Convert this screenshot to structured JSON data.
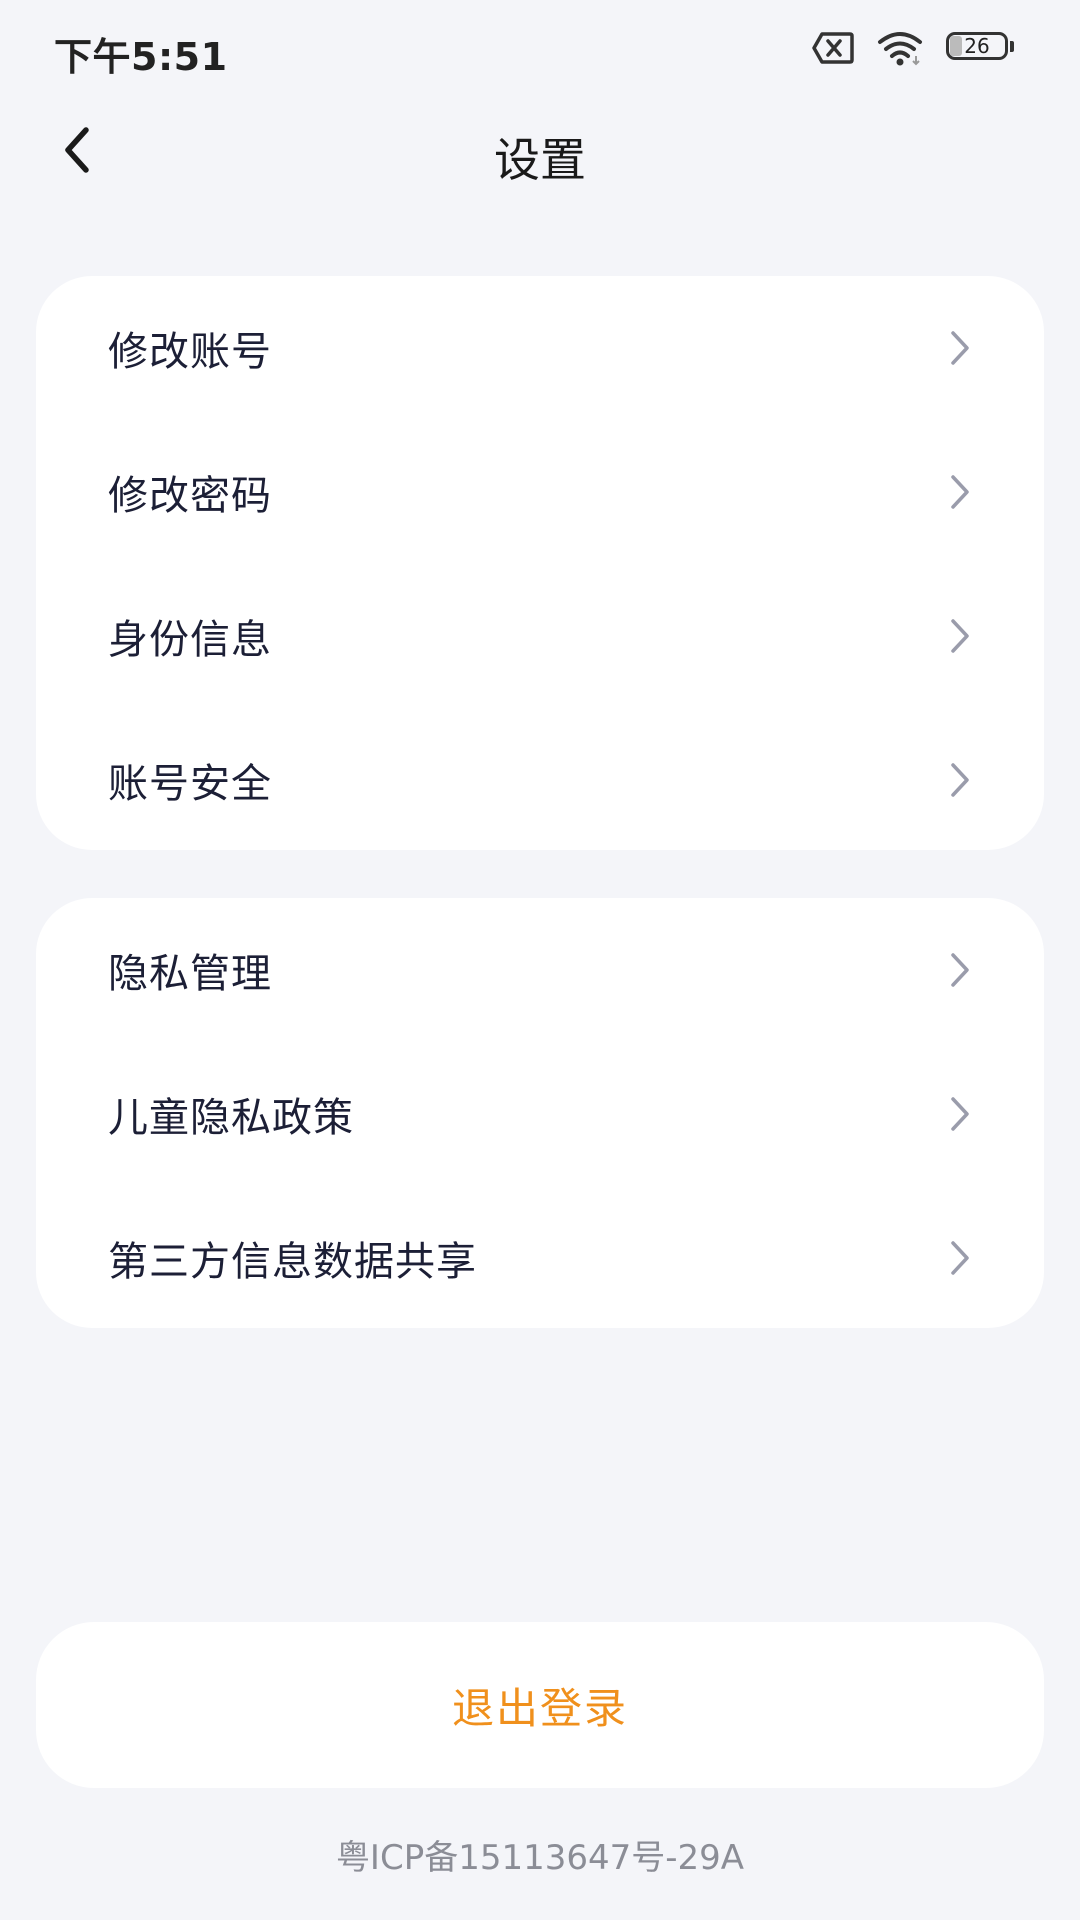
{
  "status_bar": {
    "time": "下午5:51",
    "battery_level": "26",
    "icons": [
      "sim-error-icon",
      "wifi-icon",
      "battery-icon"
    ]
  },
  "header": {
    "title": "设置",
    "back_icon": "chevron-left-icon"
  },
  "group_1": {
    "items": [
      {
        "label": "修改账号"
      },
      {
        "label": "修改密码"
      },
      {
        "label": "身份信息"
      },
      {
        "label": "账号安全"
      }
    ]
  },
  "group_2": {
    "items": [
      {
        "label": "隐私管理"
      },
      {
        "label": "儿童隐私政策"
      },
      {
        "label": "第三方信息数据共享"
      }
    ]
  },
  "logout": {
    "label": "退出登录",
    "color": "#f0901c"
  },
  "footer": {
    "icp": "粤ICP备15113647号-29A"
  },
  "colors": {
    "background": "#f4f5f9",
    "card": "#ffffff",
    "text": "#1c1f36",
    "chevron": "#9a9cab"
  }
}
